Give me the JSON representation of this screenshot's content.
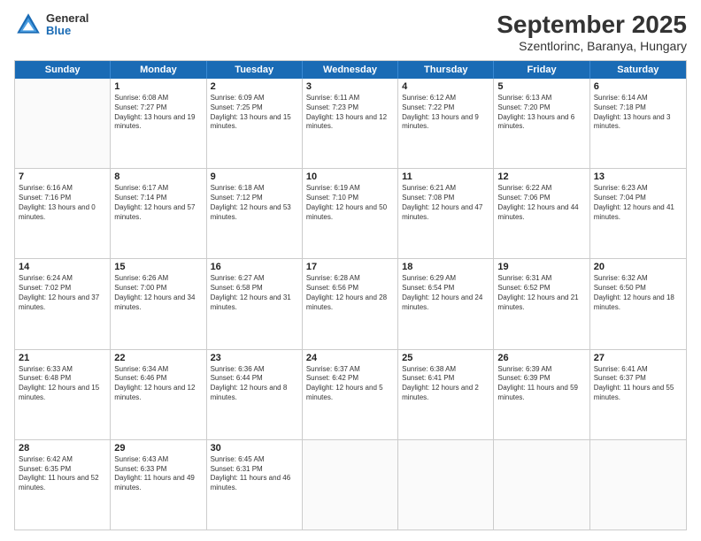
{
  "header": {
    "logo": {
      "general": "General",
      "blue": "Blue"
    },
    "title": "September 2025",
    "subtitle": "Szentlorinc, Baranya, Hungary"
  },
  "calendar": {
    "days_of_week": [
      "Sunday",
      "Monday",
      "Tuesday",
      "Wednesday",
      "Thursday",
      "Friday",
      "Saturday"
    ],
    "weeks": [
      [
        {
          "day": "",
          "empty": true
        },
        {
          "day": "1",
          "sunrise": "6:08 AM",
          "sunset": "7:27 PM",
          "daylight": "13 hours and 19 minutes."
        },
        {
          "day": "2",
          "sunrise": "6:09 AM",
          "sunset": "7:25 PM",
          "daylight": "13 hours and 15 minutes."
        },
        {
          "day": "3",
          "sunrise": "6:11 AM",
          "sunset": "7:23 PM",
          "daylight": "13 hours and 12 minutes."
        },
        {
          "day": "4",
          "sunrise": "6:12 AM",
          "sunset": "7:22 PM",
          "daylight": "13 hours and 9 minutes."
        },
        {
          "day": "5",
          "sunrise": "6:13 AM",
          "sunset": "7:20 PM",
          "daylight": "13 hours and 6 minutes."
        },
        {
          "day": "6",
          "sunrise": "6:14 AM",
          "sunset": "7:18 PM",
          "daylight": "13 hours and 3 minutes."
        }
      ],
      [
        {
          "day": "7",
          "sunrise": "6:16 AM",
          "sunset": "7:16 PM",
          "daylight": "13 hours and 0 minutes."
        },
        {
          "day": "8",
          "sunrise": "6:17 AM",
          "sunset": "7:14 PM",
          "daylight": "12 hours and 57 minutes."
        },
        {
          "day": "9",
          "sunrise": "6:18 AM",
          "sunset": "7:12 PM",
          "daylight": "12 hours and 53 minutes."
        },
        {
          "day": "10",
          "sunrise": "6:19 AM",
          "sunset": "7:10 PM",
          "daylight": "12 hours and 50 minutes."
        },
        {
          "day": "11",
          "sunrise": "6:21 AM",
          "sunset": "7:08 PM",
          "daylight": "12 hours and 47 minutes."
        },
        {
          "day": "12",
          "sunrise": "6:22 AM",
          "sunset": "7:06 PM",
          "daylight": "12 hours and 44 minutes."
        },
        {
          "day": "13",
          "sunrise": "6:23 AM",
          "sunset": "7:04 PM",
          "daylight": "12 hours and 41 minutes."
        }
      ],
      [
        {
          "day": "14",
          "sunrise": "6:24 AM",
          "sunset": "7:02 PM",
          "daylight": "12 hours and 37 minutes."
        },
        {
          "day": "15",
          "sunrise": "6:26 AM",
          "sunset": "7:00 PM",
          "daylight": "12 hours and 34 minutes."
        },
        {
          "day": "16",
          "sunrise": "6:27 AM",
          "sunset": "6:58 PM",
          "daylight": "12 hours and 31 minutes."
        },
        {
          "day": "17",
          "sunrise": "6:28 AM",
          "sunset": "6:56 PM",
          "daylight": "12 hours and 28 minutes."
        },
        {
          "day": "18",
          "sunrise": "6:29 AM",
          "sunset": "6:54 PM",
          "daylight": "12 hours and 24 minutes."
        },
        {
          "day": "19",
          "sunrise": "6:31 AM",
          "sunset": "6:52 PM",
          "daylight": "12 hours and 21 minutes."
        },
        {
          "day": "20",
          "sunrise": "6:32 AM",
          "sunset": "6:50 PM",
          "daylight": "12 hours and 18 minutes."
        }
      ],
      [
        {
          "day": "21",
          "sunrise": "6:33 AM",
          "sunset": "6:48 PM",
          "daylight": "12 hours and 15 minutes."
        },
        {
          "day": "22",
          "sunrise": "6:34 AM",
          "sunset": "6:46 PM",
          "daylight": "12 hours and 12 minutes."
        },
        {
          "day": "23",
          "sunrise": "6:36 AM",
          "sunset": "6:44 PM",
          "daylight": "12 hours and 8 minutes."
        },
        {
          "day": "24",
          "sunrise": "6:37 AM",
          "sunset": "6:42 PM",
          "daylight": "12 hours and 5 minutes."
        },
        {
          "day": "25",
          "sunrise": "6:38 AM",
          "sunset": "6:41 PM",
          "daylight": "12 hours and 2 minutes."
        },
        {
          "day": "26",
          "sunrise": "6:39 AM",
          "sunset": "6:39 PM",
          "daylight": "11 hours and 59 minutes."
        },
        {
          "day": "27",
          "sunrise": "6:41 AM",
          "sunset": "6:37 PM",
          "daylight": "11 hours and 55 minutes."
        }
      ],
      [
        {
          "day": "28",
          "sunrise": "6:42 AM",
          "sunset": "6:35 PM",
          "daylight": "11 hours and 52 minutes."
        },
        {
          "day": "29",
          "sunrise": "6:43 AM",
          "sunset": "6:33 PM",
          "daylight": "11 hours and 49 minutes."
        },
        {
          "day": "30",
          "sunrise": "6:45 AM",
          "sunset": "6:31 PM",
          "daylight": "11 hours and 46 minutes."
        },
        {
          "day": "",
          "empty": true
        },
        {
          "day": "",
          "empty": true
        },
        {
          "day": "",
          "empty": true
        },
        {
          "day": "",
          "empty": true
        }
      ]
    ]
  }
}
